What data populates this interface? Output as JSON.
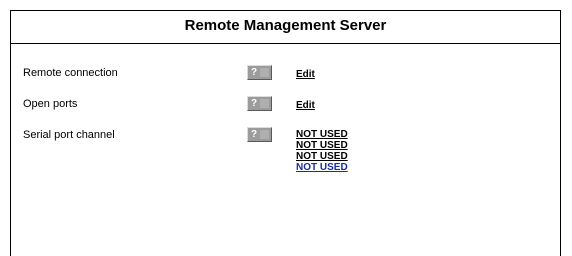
{
  "page": {
    "title": "Remote Management Server"
  },
  "rows": [
    {
      "label": "Remote connection",
      "help": "?",
      "link": "Edit"
    },
    {
      "label": "Open ports",
      "help": "?",
      "link": "Edit"
    },
    {
      "label": "Serial port channel",
      "help": "?",
      "links": [
        "NOT USED",
        "NOT USED",
        "NOT USED",
        "NOT USED"
      ]
    }
  ],
  "colors": {
    "border": "#000000",
    "help_button": "#9c9c9c",
    "visited_link": "#000000",
    "link": "#1a2d9c"
  }
}
